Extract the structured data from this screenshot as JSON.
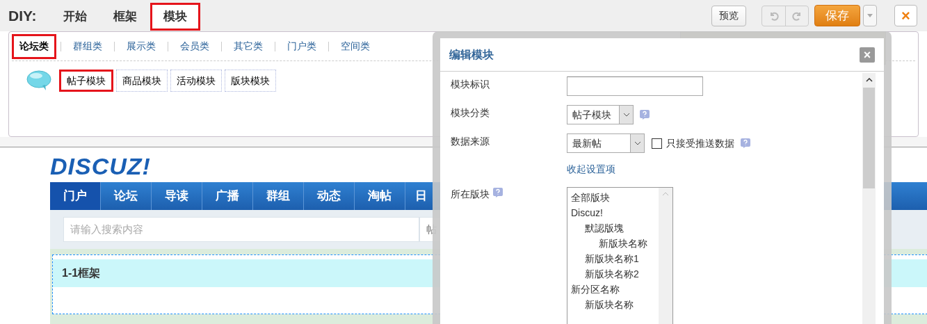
{
  "toolbar": {
    "label": "DIY:",
    "tabs": [
      {
        "label": "开始",
        "selected": false,
        "highlighted": false
      },
      {
        "label": "框架",
        "selected": false,
        "highlighted": false
      },
      {
        "label": "模块",
        "selected": true,
        "highlighted": true
      }
    ],
    "buttons": {
      "preview": "预览",
      "save": "保存",
      "close": "×"
    }
  },
  "categories": [
    {
      "label": "论坛类",
      "selected": true,
      "highlighted": true
    },
    {
      "label": "群组类",
      "selected": false,
      "highlighted": false
    },
    {
      "label": "展示类",
      "selected": false,
      "highlighted": false
    },
    {
      "label": "会员类",
      "selected": false,
      "highlighted": false
    },
    {
      "label": "其它类",
      "selected": false,
      "highlighted": false
    },
    {
      "label": "门户类",
      "selected": false,
      "highlighted": false
    },
    {
      "label": "空间类",
      "selected": false,
      "highlighted": false
    }
  ],
  "modules": [
    {
      "label": "帖子模块",
      "highlighted": true
    },
    {
      "label": "商品模块",
      "highlighted": false
    },
    {
      "label": "活动模块",
      "highlighted": false
    },
    {
      "label": "版块模块",
      "highlighted": false
    }
  ],
  "site": {
    "logo": "DISCUZ!",
    "nav": [
      {
        "label": "门户",
        "selected": true
      },
      {
        "label": "论坛",
        "selected": false
      },
      {
        "label": "导读",
        "selected": false
      },
      {
        "label": "广播",
        "selected": false
      },
      {
        "label": "群组",
        "selected": false
      },
      {
        "label": "动态",
        "selected": false
      },
      {
        "label": "淘帖",
        "selected": false
      },
      {
        "label": "日",
        "selected": false
      }
    ],
    "search": {
      "placeholder": "请输入搜索内容",
      "type": "帖"
    },
    "frame_title": "1-1框架"
  },
  "dialog": {
    "title": "编辑模块",
    "close": "×",
    "fields": [
      {
        "kind": "input",
        "label": "模块标识"
      },
      {
        "kind": "select",
        "label": "模块分类",
        "value": "帖子模块",
        "help": true
      },
      {
        "kind": "select_check",
        "label": "数据来源",
        "value": "最新帖",
        "checkbox": {
          "label": "只接受推送数据",
          "checked": false
        },
        "help": true
      }
    ],
    "toggle_link": "收起设置项",
    "forum": {
      "label": "所在版块",
      "help": true,
      "tree": [
        {
          "label": "全部版块"
        },
        {
          "label": "Discuz!",
          "children": [
            {
              "label": "默認版塊",
              "children": [
                {
                  "label": "新版块名称"
                }
              ]
            },
            {
              "label": "新版块名称1"
            },
            {
              "label": "新版块名称2"
            }
          ]
        },
        {
          "label": "新分区名称",
          "children": [
            {
              "label": "新版块名称"
            }
          ]
        }
      ]
    }
  }
}
